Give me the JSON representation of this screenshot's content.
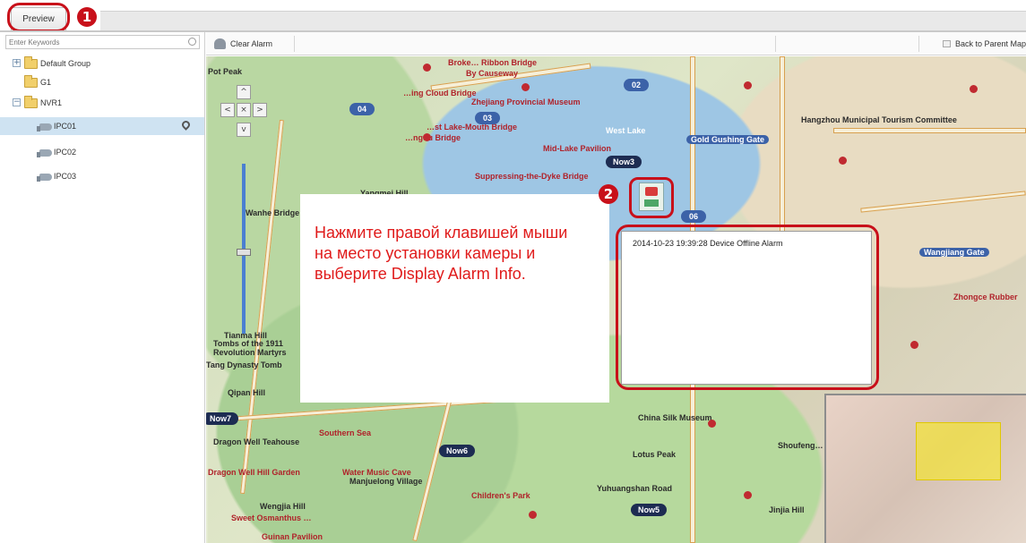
{
  "tabs": [
    {
      "label": "Preview"
    }
  ],
  "badges": {
    "step1": "1",
    "step2": "2"
  },
  "search": {
    "placeholder": "Enter Keywords"
  },
  "tree": {
    "items": [
      {
        "label": "Default Group"
      },
      {
        "label": "G1"
      },
      {
        "label": "NVR1"
      },
      {
        "label": "IPC01"
      },
      {
        "label": "IPC02"
      },
      {
        "label": "IPC03"
      }
    ]
  },
  "toolbar": {
    "clear_alarm_label": "Clear Alarm",
    "back_label": "Back to Parent Map"
  },
  "map": {
    "labels": [
      "Pot Peak",
      "Broke… Ribbon Bridge",
      "By Causeway",
      "Zhejiang Provincial Museum",
      "…ing Cloud Bridge",
      "…st Lake-Mouth Bridge",
      "…ngdu Bridge",
      "Mid-Lake Pavilion",
      "Suppressing-the-Dyke Bridge",
      "Gold Gushing Gate",
      "Wangjiang Gate",
      "Zhongce Rubber",
      "Tianma Hill",
      "Qipan Hill",
      "Dragon Well Teahouse",
      "Southern Sea",
      "China Silk Museum",
      "Hangzhou Municipal Tourism Committee",
      "Dragon Well Hill Garden",
      "Water Music Cave",
      "Manjuelong Village",
      "Wengjia Hill",
      "Sweet Osmanthus …",
      "Children's Park",
      "Yuhuangshan Road",
      "Jinjia Hill",
      "Guinan Pavilion",
      "Lotus Peak",
      "Shoufeng…",
      "Yangmei Hill",
      "West Lake",
      "Wanhe Bridge",
      "Tombs of the 1911 Revolution Martyrs",
      "Tang Dynasty Tomb"
    ],
    "route_tags": [
      "04",
      "03",
      "02",
      "06"
    ],
    "now_tags": [
      "Now3",
      "Now6",
      "Now5",
      "Now7"
    ]
  },
  "callout": {
    "text": "Нажмите правой клавишей мыши на место установки камеры и выберите Display Alarm Info."
  },
  "alarm": {
    "entry": "2014-10-23 19:39:28  Device Offline Alarm"
  },
  "colors": {
    "highlight": "#c8101a",
    "accent": "#3c62a8",
    "selected_row": "#cfe3f2",
    "callout_text": "#e01b1b"
  }
}
